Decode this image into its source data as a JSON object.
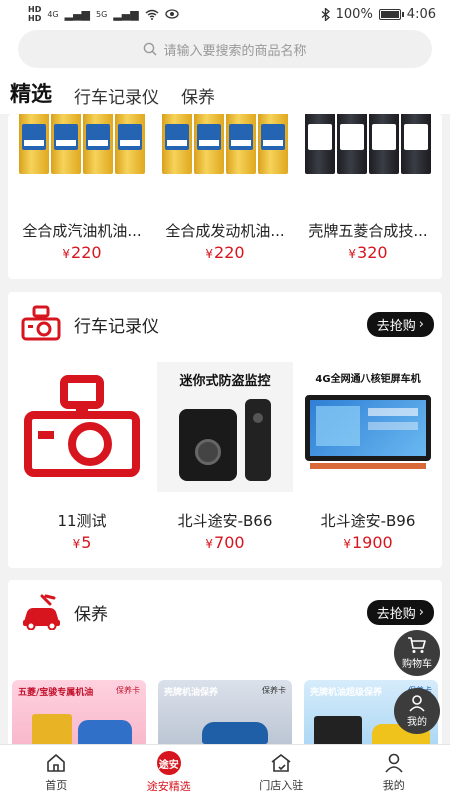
{
  "status_bar": {
    "left_labels": [
      "HD",
      "HD",
      "4G",
      "5G"
    ],
    "battery": "100%",
    "time": "4:06"
  },
  "search": {
    "placeholder": "请输入要搜索的商品名称"
  },
  "top_tabs": [
    {
      "label": "精选",
      "active": true
    },
    {
      "label": "行车记录仪",
      "active": false
    },
    {
      "label": "保养",
      "active": false
    }
  ],
  "oil_section": {
    "products": [
      {
        "name": "全合成汽油机油...",
        "currency": "¥",
        "price": "220",
        "can_style": "gold"
      },
      {
        "name": "全合成发动机油...",
        "currency": "¥",
        "price": "220",
        "can_style": "gold"
      },
      {
        "name": "壳牌五菱合成技...",
        "currency": "¥",
        "price": "320",
        "can_style": "shell"
      }
    ]
  },
  "dashcam_section": {
    "title": "行车记录仪",
    "button": "去抢购",
    "image_captions": [
      "迷你式防盗监控",
      "4G全网通八核钜屏车机"
    ],
    "products": [
      {
        "name": "11测试",
        "currency": "¥",
        "price": "5"
      },
      {
        "name": "北斗途安-B66",
        "currency": "¥",
        "price": "700"
      },
      {
        "name": "北斗途安-B96",
        "currency": "¥",
        "price": "1900"
      }
    ]
  },
  "maintenance_section": {
    "title": "保养",
    "button": "去抢购",
    "cards": [
      {
        "caption": "五菱/宝骏专属机油",
        "tag": "保养卡"
      },
      {
        "caption": "壳牌机油保养",
        "tag": "保养卡"
      },
      {
        "caption": "壳牌机油超级保养",
        "tag": "保养卡"
      }
    ]
  },
  "floating": {
    "cart": "购物车",
    "mine": "我的"
  },
  "bottom_nav": [
    {
      "label": "首页",
      "icon": "home-icon"
    },
    {
      "label": "途安精选",
      "icon": "tuan-badge-icon",
      "badge": "途安",
      "active": true
    },
    {
      "label": "门店入驻",
      "icon": "store-icon"
    },
    {
      "label": "我的",
      "icon": "person-icon"
    }
  ],
  "colors": {
    "accent": "#d7151e",
    "button_bg": "#111111",
    "float_bg": "#3c3c3c"
  }
}
